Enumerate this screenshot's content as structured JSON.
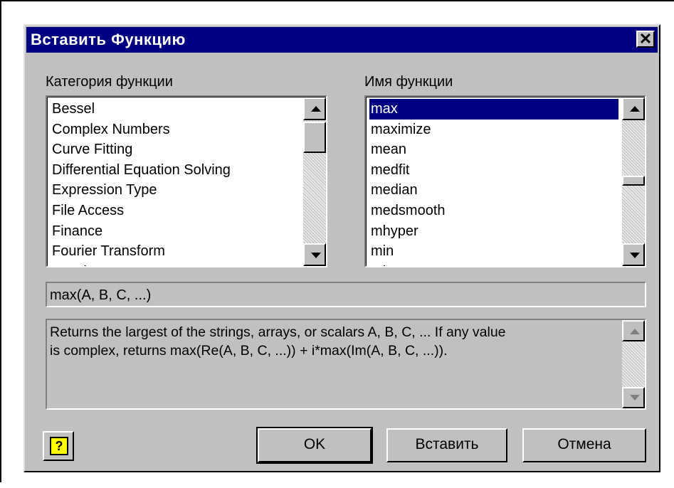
{
  "dialog": {
    "title": "Вставить Функцию",
    "close_label": "✕"
  },
  "category": {
    "label": "Категория функции",
    "items": [
      "Bessel",
      "Complex Numbers",
      "Curve Fitting",
      "Differential Equation Solving",
      "Expression Type",
      "File Access",
      "Finance",
      "Fourier Transform",
      "Graph"
    ]
  },
  "function": {
    "label": "Имя функции",
    "items": [
      "max",
      "maximize",
      "mean",
      "medfit",
      "median",
      "medsmooth",
      "mhyper",
      "min",
      "minerr"
    ],
    "selected": "max"
  },
  "signature": "max(A, B, C, ...)",
  "description": {
    "line1": "Returns the largest of the strings, arrays, or scalars A, B, C, ... If any value",
    "line2": "is complex, returns max(Re(A, B, C, ...)) + i*max(Im(A, B, C, ...))."
  },
  "buttons": {
    "ok": "OK",
    "insert": "Вставить",
    "cancel": "Отмена"
  },
  "icons": {
    "help": "help-icon",
    "close": "close-icon",
    "help_glyph": "?"
  },
  "colors": {
    "titlebar": "#000080",
    "dialog_bg": "#c0c0c0",
    "selection": "#000080"
  }
}
